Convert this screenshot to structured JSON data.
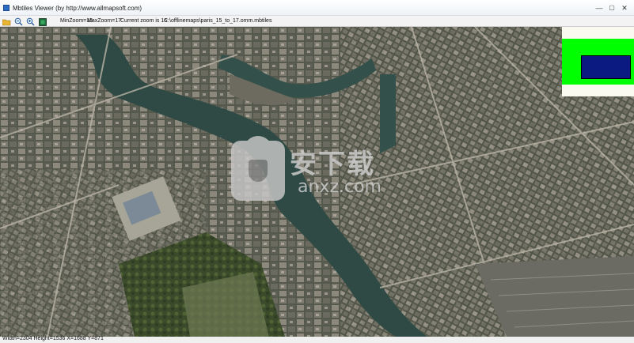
{
  "window": {
    "title": "Mbtiles Viewer    (by http://www.allmapsoft.com)",
    "controls": {
      "minimize": "—",
      "maximize": "▢",
      "close": "✕"
    }
  },
  "toolbar": {
    "icons": [
      "open-folder-icon",
      "zoom-out-icon",
      "zoom-in-icon",
      "layer-icon"
    ],
    "min_zoom": "MinZoom=15",
    "max_zoom": "MaxZoom=17",
    "current_zoom": "Current zoom is 16",
    "file_path": "C:\\offlinemaps\\paris_15_to_17.omm.mbtiles"
  },
  "map": {
    "content": "satellite-imagery",
    "overview_colors": {
      "background": "#fafaf0",
      "extent": "#00ff00",
      "viewport": "#0a1a80"
    }
  },
  "watermark": {
    "chinese": "安下载",
    "url": "anxz.com"
  },
  "status": {
    "text": "Width=2304 Height=1536  X=1688 Y=871"
  }
}
